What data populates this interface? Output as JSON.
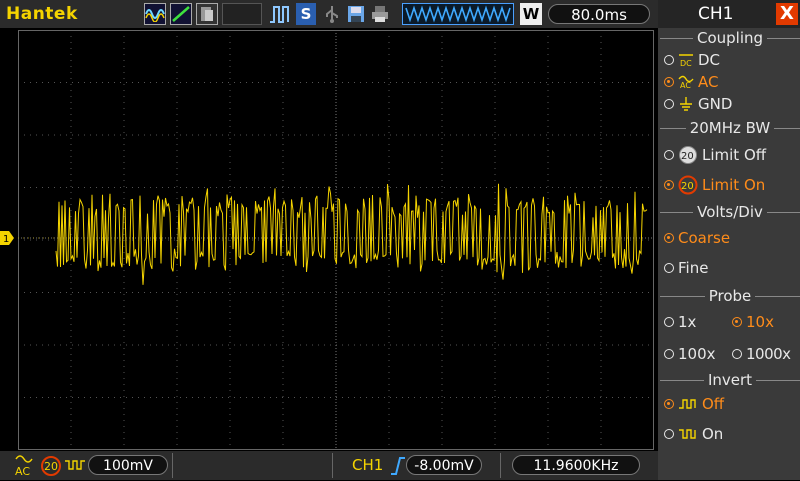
{
  "brand": "Hantek",
  "toolbar": {
    "run_mode_letter": "S",
    "window_letter": "W",
    "timebase": "80.0ms"
  },
  "channel_marker": "1",
  "bottom": {
    "coupling_top": "AC",
    "bw_badge": "20",
    "volts_div": "100mV",
    "trigger_channel": "CH1",
    "trigger_level": "-8.00mV",
    "frequency": "11.9600KHz"
  },
  "panel": {
    "title": "CH1",
    "close": "X",
    "coupling": {
      "title": "Coupling",
      "options": [
        "DC",
        "AC",
        "GND"
      ],
      "selected": "AC"
    },
    "bandwidth": {
      "title": "20MHz BW",
      "options": [
        "Limit Off",
        "Limit On"
      ],
      "selected": "Limit On",
      "badge": "20"
    },
    "volts": {
      "title": "Volts/Div",
      "options": [
        "Coarse",
        "Fine"
      ],
      "selected": "Coarse"
    },
    "probe": {
      "title": "Probe",
      "options": [
        "1x",
        "10x",
        "100x",
        "1000x"
      ],
      "selected": "10x"
    },
    "invert": {
      "title": "Invert",
      "options": [
        "Off",
        "On"
      ],
      "selected": "Off"
    }
  },
  "colors": {
    "trace": "#f5d400",
    "selected": "#ff8c1a",
    "panel_bg": "#3a3a3a",
    "close": "#e23a00"
  }
}
